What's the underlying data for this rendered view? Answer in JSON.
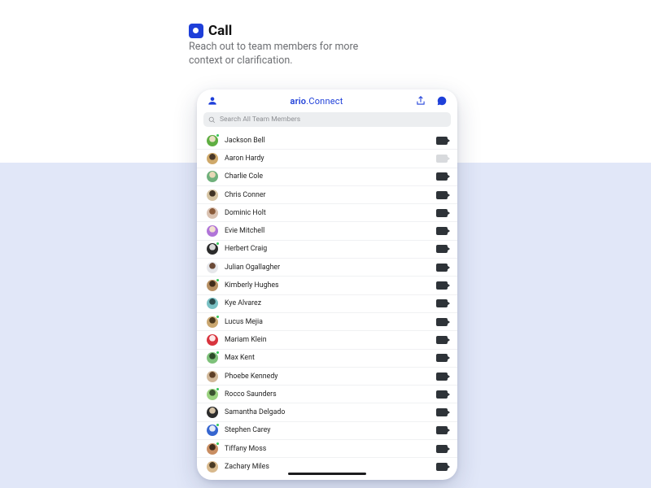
{
  "headline": {
    "title": "Call",
    "subtitle": "Reach out to team members for more context or clarification."
  },
  "app": {
    "brand_primary": "ario",
    "brand_secondary": ".Connect"
  },
  "search": {
    "placeholder": "Search All Team Members"
  },
  "colors": {
    "accent": "#1e3fd9",
    "presence": "#34c759"
  },
  "members": [
    {
      "name": "Jackson  Bell",
      "avatar_bg": "#5fae42",
      "avatar_fg": "#eadfc4",
      "online": true,
      "call_enabled": true
    },
    {
      "name": "Aaron Hardy",
      "avatar_bg": "#cfa96a",
      "avatar_fg": "#4a3828",
      "online": false,
      "call_enabled": false
    },
    {
      "name": "Charlie Cole",
      "avatar_bg": "#6fb07b",
      "avatar_fg": "#e7d7b6",
      "online": false,
      "call_enabled": true
    },
    {
      "name": "Chris  Conner",
      "avatar_bg": "#d6c4a3",
      "avatar_fg": "#3f3224",
      "online": false,
      "call_enabled": true
    },
    {
      "name": "Dominic Holt",
      "avatar_bg": "#dac2b1",
      "avatar_fg": "#8a5b3a",
      "online": false,
      "call_enabled": true
    },
    {
      "name": "Evie Mitchell",
      "avatar_bg": "#b074d8",
      "avatar_fg": "#f2e0cf",
      "online": false,
      "call_enabled": true
    },
    {
      "name": "Herbert Craig",
      "avatar_bg": "#2b2b2b",
      "avatar_fg": "#d9d9d9",
      "online": true,
      "call_enabled": true
    },
    {
      "name": "Julian Ogallagher",
      "avatar_bg": "#e6e7ea",
      "avatar_fg": "#6b4a37",
      "online": false,
      "call_enabled": true
    },
    {
      "name": "Kimberly  Hughes",
      "avatar_bg": "#b79063",
      "avatar_fg": "#402c1b",
      "online": true,
      "call_enabled": true
    },
    {
      "name": "Kye Alvarez",
      "avatar_bg": "#7ac1c4",
      "avatar_fg": "#2b4a4b",
      "online": false,
      "call_enabled": true
    },
    {
      "name": "Lucus Mejia",
      "avatar_bg": "#caa770",
      "avatar_fg": "#4b381e",
      "online": true,
      "call_enabled": true
    },
    {
      "name": "Mariam Klein",
      "avatar_bg": "#d8343e",
      "avatar_fg": "#ffe8e8",
      "online": false,
      "call_enabled": true
    },
    {
      "name": "Max Kent",
      "avatar_bg": "#7ec17a",
      "avatar_fg": "#2e4a2b",
      "online": true,
      "call_enabled": true
    },
    {
      "name": "Phoebe Kennedy",
      "avatar_bg": "#d1b899",
      "avatar_fg": "#5d3f26",
      "online": false,
      "call_enabled": true
    },
    {
      "name": "Rocco Saunders",
      "avatar_bg": "#9ad27f",
      "avatar_fg": "#3a5230",
      "online": true,
      "call_enabled": true
    },
    {
      "name": "Samantha Delgado",
      "avatar_bg": "#2c2c2c",
      "avatar_fg": "#d6c4a8",
      "online": false,
      "call_enabled": true
    },
    {
      "name": "Stephen Carey",
      "avatar_bg": "#3666d0",
      "avatar_fg": "#e6ebf7",
      "online": true,
      "call_enabled": true
    },
    {
      "name": "Tiffany Moss",
      "avatar_bg": "#c98e62",
      "avatar_fg": "#3f2b1c",
      "online": true,
      "call_enabled": true
    },
    {
      "name": "Zachary Miles",
      "avatar_bg": "#d8b98d",
      "avatar_fg": "#4a3a24",
      "online": false,
      "call_enabled": true
    }
  ]
}
